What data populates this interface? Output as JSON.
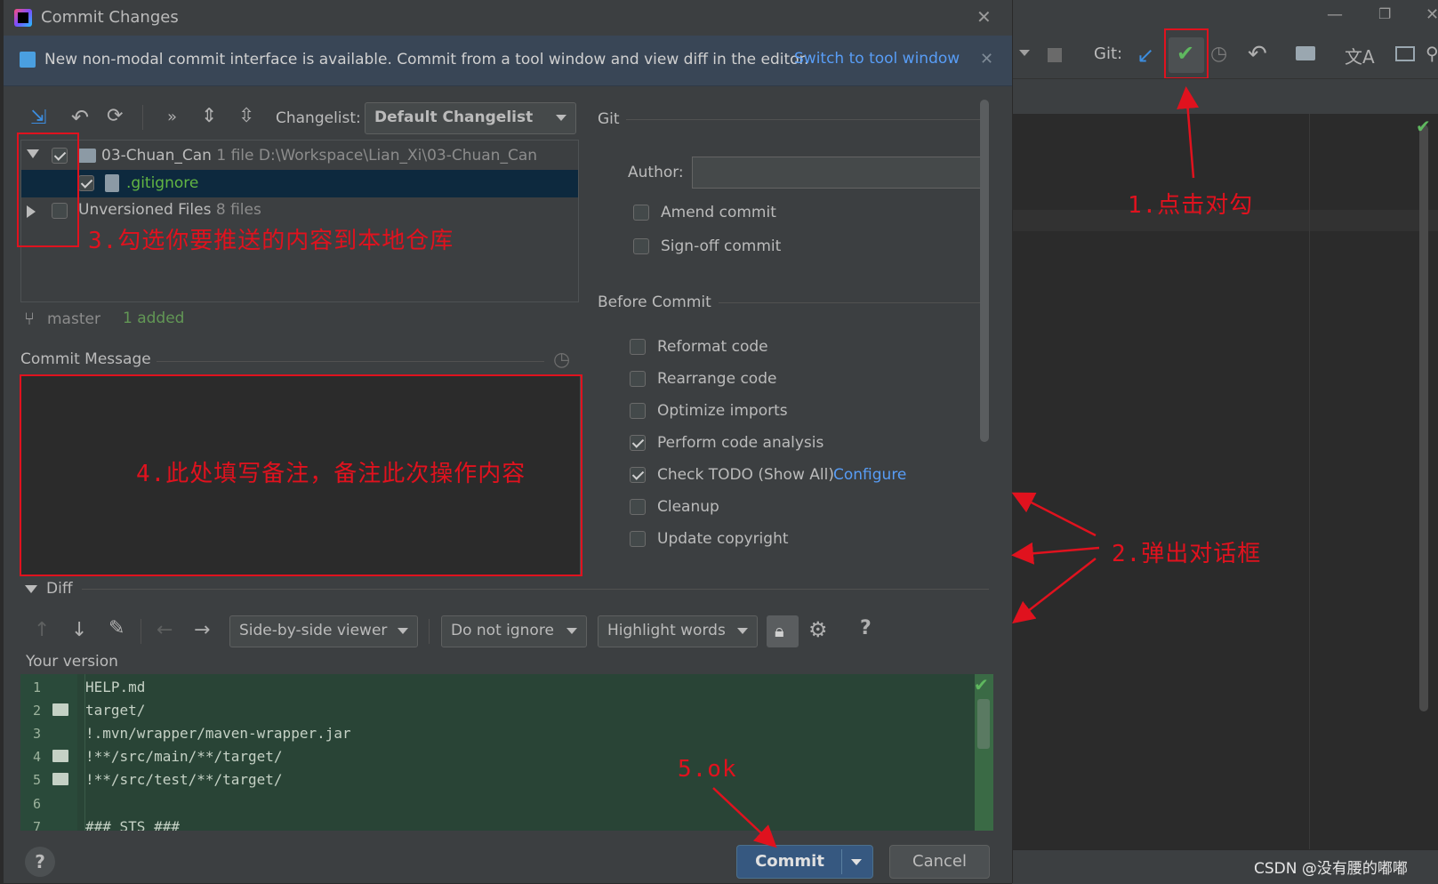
{
  "dialog": {
    "title": "Commit Changes",
    "banner_text": "New non-modal commit interface is available. Commit from a tool window and view diff in the editor.",
    "banner_link": "Switch to tool window",
    "changelist_label": "Changelist:",
    "changelist_value": "Default Changelist",
    "tree": [
      {
        "name": "03-Chuan_Can",
        "count": "1 file",
        "path": "D:\\Workspace\\Lian_Xi\\03-Chuan_Can",
        "checked": true
      },
      {
        "name": ".gitignore",
        "checked": true
      },
      {
        "name": "Unversioned Files",
        "count": "8 files",
        "checked": false
      }
    ],
    "branch": "master",
    "branch_status": "1 added",
    "commit_message_label": "Commit Message",
    "git_section": "Git",
    "author_label": "Author:",
    "author_value": "",
    "options": [
      {
        "label": "Amend commit",
        "checked": false
      },
      {
        "label": "Sign-off commit",
        "checked": false
      }
    ],
    "before_commit_title": "Before Commit",
    "before_commit": [
      {
        "label": "Reformat code",
        "checked": false
      },
      {
        "label": "Rearrange code",
        "checked": false
      },
      {
        "label": "Optimize imports",
        "checked": false
      },
      {
        "label": "Perform code analysis",
        "checked": true
      },
      {
        "label": "Check TODO (Show All)",
        "checked": true,
        "link": "Configure"
      },
      {
        "label": "Cleanup",
        "checked": false
      },
      {
        "label": "Update copyright",
        "checked": false
      }
    ],
    "diff_label": "Diff",
    "viewer_select": "Side-by-side viewer",
    "ignore_select": "Do not ignore",
    "highlight_select": "Highlight words",
    "help_glyph": "?",
    "your_version": "Your version",
    "diff_lines": [
      {
        "n": "1",
        "text": "HELP.md",
        "folder": false
      },
      {
        "n": "2",
        "text": "target/",
        "folder": true
      },
      {
        "n": "3",
        "text": "!.mvn/wrapper/maven-wrapper.jar",
        "folder": false
      },
      {
        "n": "4",
        "text": "!**/src/main/**/target/",
        "folder": true
      },
      {
        "n": "5",
        "text": "!**/src/test/**/target/",
        "folder": true
      },
      {
        "n": "6",
        "text": "",
        "folder": false
      },
      {
        "n": "7",
        "text": "### STS ###",
        "folder": false
      }
    ],
    "commit_button": "Commit",
    "cancel_button": "Cancel"
  },
  "ide": {
    "git_label": "Git:",
    "watermark": "CSDN @没有腰的嘟嘟"
  },
  "annotations": {
    "step1": "1.点击对勾",
    "step2": "2.弹出对话框",
    "step3": "3.勾选你要推送的内容到本地仓库",
    "step4": "4.此处填写备注，备注此次操作内容",
    "step5": "5.ok"
  },
  "colors": {
    "accent_link": "#589df6",
    "annotation_red": "#e0121e",
    "diff_green": "#294436",
    "commit_button": "#365880",
    "added_green": "#629755"
  }
}
